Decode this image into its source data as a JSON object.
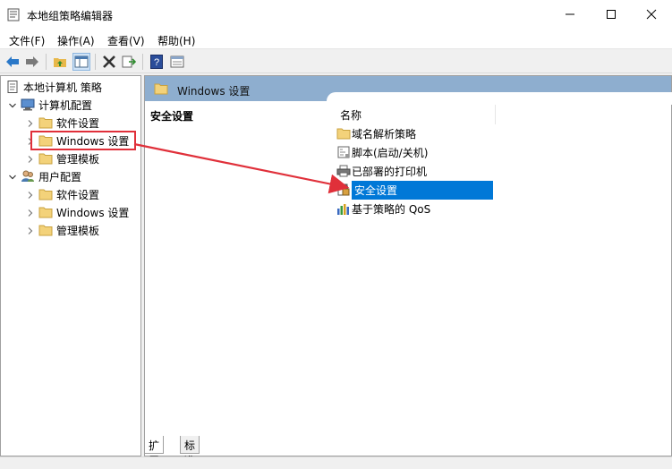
{
  "window": {
    "title": "本地组策略编辑器"
  },
  "menu": [
    "文件(F)",
    "操作(A)",
    "查看(V)",
    "帮助(H)"
  ],
  "tree": {
    "root": "本地计算机 策略",
    "computer_config": "计算机配置",
    "software_settings": "软件设置",
    "windows_settings": "Windows 设置",
    "admin_templates": "管理模板",
    "user_config": "用户配置",
    "user_software_settings": "软件设置",
    "user_windows_settings": "Windows 设置",
    "user_admin_templates": "管理模板"
  },
  "content": {
    "header": "Windows 设置",
    "description_title": "安全设置",
    "column_name": "名称",
    "items": [
      {
        "label": "域名解析策略",
        "icon": "folder-icon",
        "selected": false
      },
      {
        "label": "脚本(启动/关机)",
        "icon": "script-icon",
        "selected": false
      },
      {
        "label": "已部署的打印机",
        "icon": "printer-icon",
        "selected": false
      },
      {
        "label": "安全设置",
        "icon": "security-icon",
        "selected": true
      },
      {
        "label": "基于策略的 QoS",
        "icon": "qos-chart-icon",
        "selected": false
      }
    ]
  },
  "tabs": {
    "extended": "扩展",
    "standard": "标准"
  },
  "colors": {
    "selection": "#0078d7",
    "header_band": "#8eaecf",
    "highlight": "#e0303a",
    "folder": "#f3d27a"
  }
}
